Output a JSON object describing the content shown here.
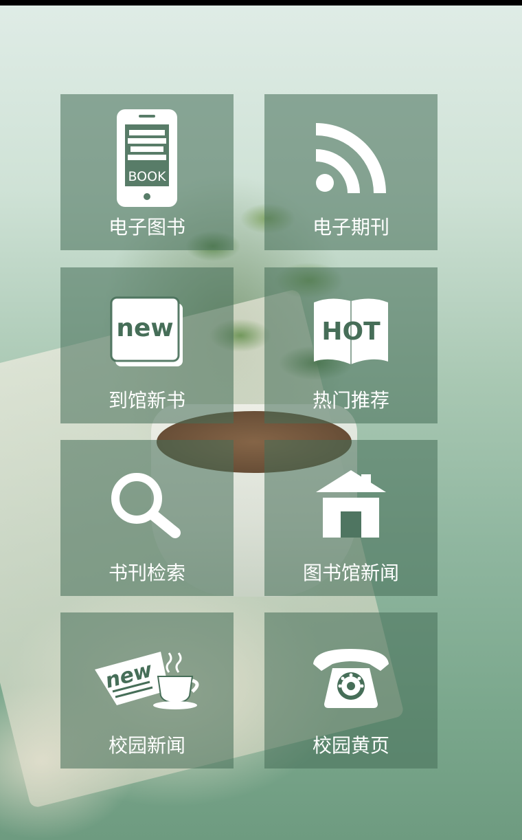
{
  "menu": {
    "items": [
      {
        "label": "电子图书",
        "icon": "ebook-phone-icon",
        "icon_text": "BOOK"
      },
      {
        "label": "电子期刊",
        "icon": "rss-icon"
      },
      {
        "label": "到馆新书",
        "icon": "new-book-icon",
        "icon_text": "new"
      },
      {
        "label": "热门推荐",
        "icon": "hot-book-icon",
        "icon_text": "HOT"
      },
      {
        "label": "书刊检索",
        "icon": "search-icon"
      },
      {
        "label": "图书馆新闻",
        "icon": "house-icon"
      },
      {
        "label": "校园新闻",
        "icon": "news-coffee-icon",
        "icon_text": "new"
      },
      {
        "label": "校园黄页",
        "icon": "telephone-icon"
      }
    ]
  },
  "theme": {
    "tile_color": "#466E58",
    "text_color": "#FFFFFF"
  }
}
